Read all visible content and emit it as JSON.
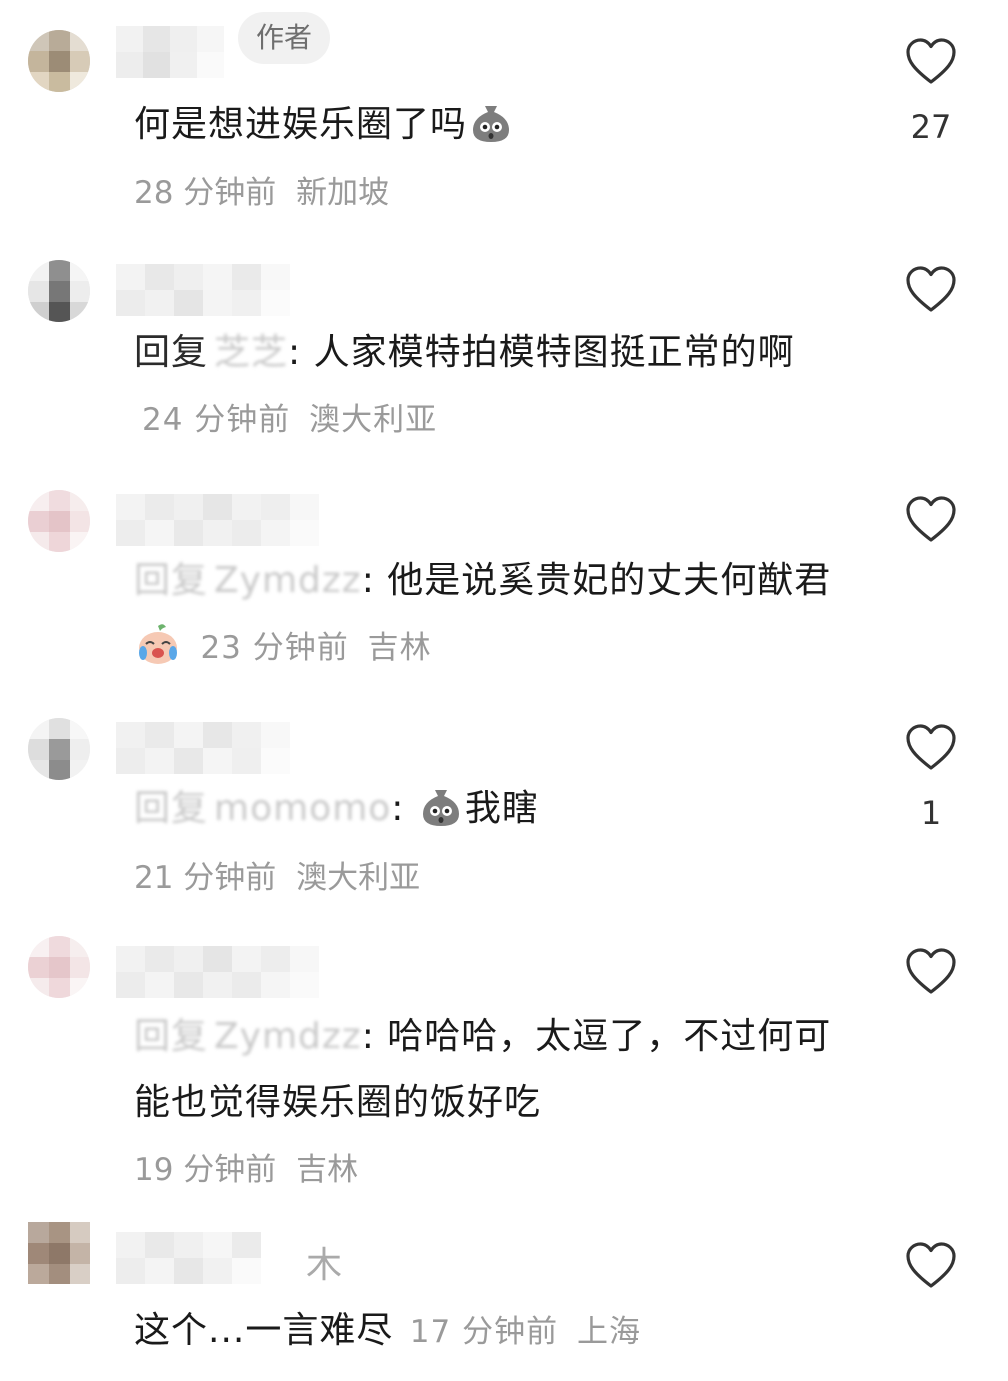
{
  "comments": [
    {
      "author_tag": "作者",
      "text": "何是想进娱乐圈了吗",
      "time": "28 分钟前",
      "location": "新加坡",
      "likes": "27",
      "emoji": "surprised-bag-emoji"
    },
    {
      "reply_prefix": "回复",
      "reply_to": "芝芝",
      "text": "人家模特拍模特图挺正常的啊",
      "time": "24 分钟前",
      "location": "澳大利亚"
    },
    {
      "reply_prefix": "回复",
      "reply_to": "Zymdzz",
      "text": "他是说奚贵妃的丈夫何猷君",
      "time": "23 分钟前",
      "location": "吉林",
      "emoji": "crying-laughing-emoji"
    },
    {
      "reply_prefix": "回复",
      "reply_to": "momomo",
      "text": "我瞎",
      "time": "21 分钟前",
      "location": "澳大利亚",
      "likes": "1",
      "emoji": "surprised-bag-emoji"
    },
    {
      "reply_prefix": "回复",
      "reply_to": "Zymdzz",
      "text": "哈哈哈，太逗了，不过何可能也觉得娱乐圈的饭好吃",
      "time": "19 分钟前",
      "location": "吉林"
    },
    {
      "name_partial": "木",
      "text": "这个...一言难尽",
      "time": "17 分钟前",
      "location": "上海"
    }
  ],
  "colors": {
    "text": "#1a1a1a",
    "meta": "#9a9a9a",
    "tag_bg": "#f1f1f1"
  }
}
